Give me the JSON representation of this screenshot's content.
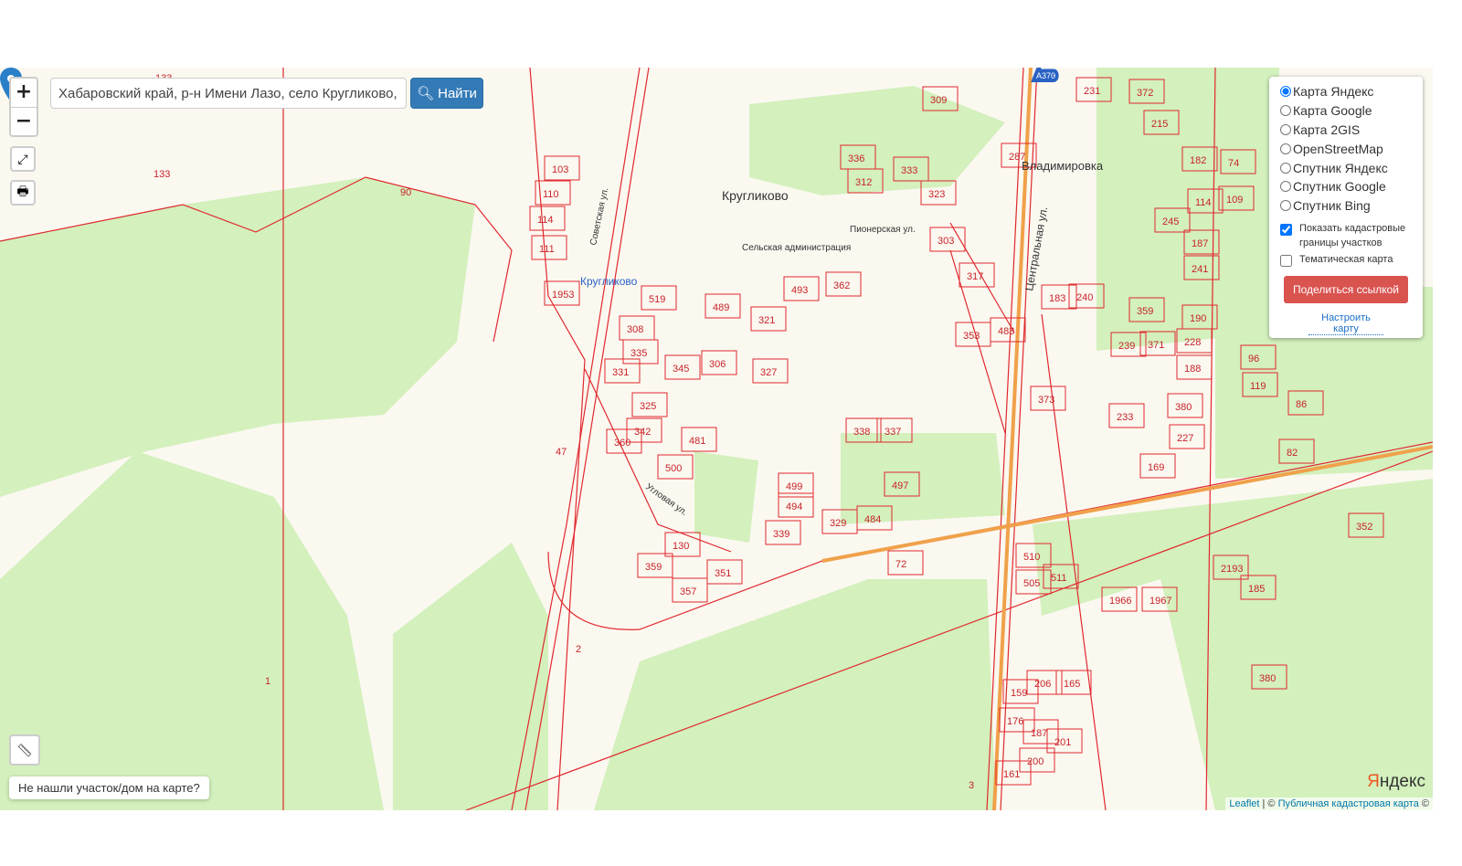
{
  "search": {
    "value": "Хабаровский край, р-н Имени Лазо, село Кругликово, ул Угловая",
    "button": "Найти"
  },
  "controls": {
    "zoom_in": "+",
    "zoom_out": "−",
    "fullscreen_icon": "expand-icon",
    "print_icon": "printer-icon",
    "ruler_icon": "ruler-icon"
  },
  "layers": {
    "options": [
      {
        "label": "Карта Яндекс",
        "checked": true
      },
      {
        "label": "Карта Google",
        "checked": false
      },
      {
        "label": "Карта 2GIS",
        "checked": false
      },
      {
        "label": "OpenStreetMap",
        "checked": false
      },
      {
        "label": "Спутник Яндекс",
        "checked": false
      },
      {
        "label": "Спутник Google",
        "checked": false
      },
      {
        "label": "Спутник Bing",
        "checked": false
      }
    ],
    "cadastral": {
      "label": "Показать кадастровые границы участков",
      "checked": true
    },
    "thematic": {
      "label": "Тематическая карта",
      "checked": false
    },
    "share": "Поделиться ссылкой",
    "setup": "Настроить карту"
  },
  "not_found": "Не нашли участок/дом на карте?",
  "map_labels": {
    "village": "Кругликово",
    "village2": "Владимировка",
    "station": "Кругликово",
    "street1": "Центральная ул.",
    "street2": "Советская ул.",
    "street3": "Угловая ул.",
    "street4": "Пионерская ул.",
    "admin": "Сельская администрация",
    "road": "А370"
  },
  "parcels": [
    "133",
    "133",
    "90",
    "1",
    "2",
    "3",
    "47",
    "308",
    "335",
    "331",
    "325",
    "342",
    "360",
    "481",
    "500",
    "499",
    "494",
    "339",
    "329",
    "484",
    "497",
    "338",
    "337",
    "362",
    "493",
    "321",
    "327",
    "306",
    "345",
    "489",
    "519",
    "303",
    "317",
    "353",
    "483",
    "373",
    "240",
    "183",
    "359",
    "239",
    "371",
    "228",
    "188",
    "380",
    "227",
    "233",
    "169",
    "119",
    "96",
    "86",
    "82",
    "215",
    "182",
    "74",
    "109",
    "114",
    "245",
    "187",
    "241",
    "190",
    "309",
    "336",
    "312",
    "333",
    "323",
    "287",
    "372",
    "231",
    "110",
    "114",
    "111",
    "103",
    "1953",
    "510",
    "505",
    "511",
    "1966",
    "1967",
    "2193",
    "185",
    "352",
    "380",
    "159",
    "206",
    "165",
    "176",
    "187",
    "201",
    "200",
    "161",
    "72",
    "357",
    "351",
    "130",
    "359"
  ],
  "attribution": {
    "leaflet": "Leaflet",
    "sep": " | © ",
    "pkk": "Публичная кадастровая карта",
    "tail": " ©"
  },
  "yandex_logo": "Яндекс",
  "colors": {
    "parcel": "#e0282e",
    "forest": "#d3f0bd",
    "land": "#fbf8f0",
    "accent": "#337ab7",
    "share": "#d9534f",
    "marker": "#2a7fc9"
  }
}
